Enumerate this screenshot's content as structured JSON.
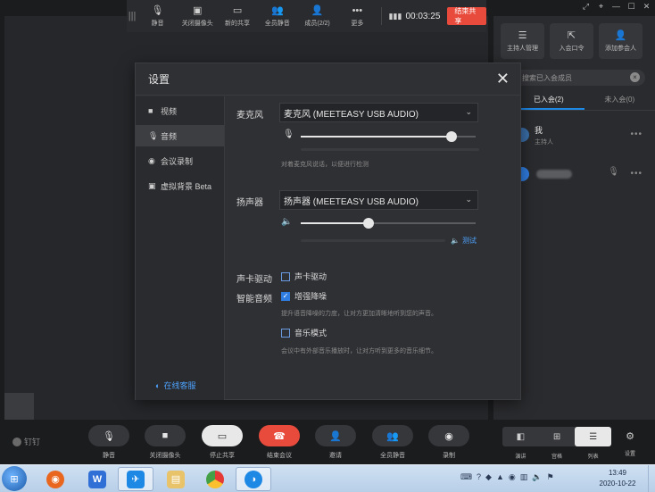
{
  "top_toolbar": {
    "items": [
      {
        "icon": "mic-icon",
        "label": "静音"
      },
      {
        "icon": "camera-icon",
        "label": "关闭摄像头"
      },
      {
        "icon": "screen-share-icon",
        "label": "新的共享"
      },
      {
        "icon": "mute-all-icon",
        "label": "全员静音"
      },
      {
        "icon": "members-icon",
        "label": "成员(2/2)"
      },
      {
        "icon": "more-icon",
        "label": "更多"
      }
    ],
    "timer": "00:03:25",
    "end_share": "结束共享"
  },
  "panel": {
    "actions": [
      {
        "icon": "host-manage-icon",
        "label": "主持人管理"
      },
      {
        "icon": "join-password-icon",
        "label": "入会口令"
      },
      {
        "icon": "add-participant-icon",
        "label": "添加参会人"
      }
    ],
    "search_placeholder": "搜索已入会成员",
    "tabs": [
      {
        "label": "已入会(2)",
        "active": true
      },
      {
        "label": "未入会(0)",
        "active": false
      }
    ],
    "members": [
      {
        "name": "我",
        "role": "主持人"
      }
    ]
  },
  "dialog": {
    "title": "设置",
    "nav": [
      {
        "icon": "video-icon",
        "label": "视频",
        "active": false
      },
      {
        "icon": "mic-icon",
        "label": "音频",
        "active": true
      },
      {
        "icon": "record-icon",
        "label": "会议录制",
        "active": false
      },
      {
        "icon": "virtual-bg-icon",
        "label": "虚拟背景 Beta",
        "active": false
      }
    ],
    "online_support": "在线客服",
    "microphone": {
      "label": "麦克风",
      "device": "麦克风 (MEETEASY USB AUDIO)",
      "volume": 0.86,
      "hint": "对着麦克风说话，以便进行检测"
    },
    "speaker": {
      "label": "扬声器",
      "device": "扬声器 (MEETEASY USB AUDIO)",
      "volume": 0.39,
      "test": "测试"
    },
    "sound_card": {
      "label": "声卡驱动",
      "option": "声卡驱动",
      "checked": false
    },
    "smart_audio": {
      "label": "智能音频",
      "denoise": "增强降噪",
      "denoise_checked": true,
      "denoise_hint": "提升语音降噪的力度，让对方更加清晰地听到您的声音。",
      "music_mode": "音乐模式",
      "music_checked": false,
      "music_hint": "会议中有外部音乐播放时，让对方听到更多的音乐细节。"
    }
  },
  "bottom_toolbar": {
    "logo_text": "钉钉",
    "items": [
      {
        "icon": "mic-icon",
        "label": "静音",
        "style": "dark"
      },
      {
        "icon": "camera-icon",
        "label": "关闭摄像头",
        "style": "dark"
      },
      {
        "icon": "stop-share-icon",
        "label": "停止共享",
        "style": "light"
      },
      {
        "icon": "hangup-icon",
        "label": "结束会议",
        "style": "red"
      },
      {
        "icon": "invite-icon",
        "label": "邀请",
        "style": "dark"
      },
      {
        "icon": "mute-all-icon",
        "label": "全员静音",
        "style": "dark"
      },
      {
        "icon": "record-icon",
        "label": "录制",
        "style": "dark"
      }
    ],
    "layout_labels": [
      "演讲",
      "宫格",
      "列表"
    ],
    "settings_label": "设置"
  },
  "taskbar": {
    "time": "13:49",
    "date": "2020-10-22"
  },
  "colors": {
    "accent_blue": "#2f7de1",
    "end_red": "#e84b3c",
    "link_blue": "#4ea3ff"
  }
}
